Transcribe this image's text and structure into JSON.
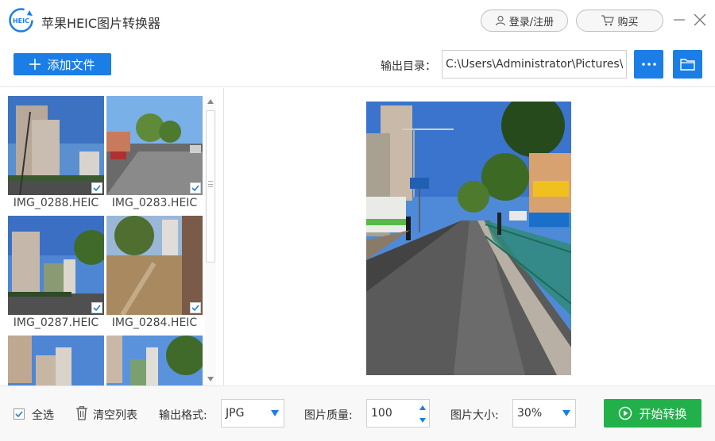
{
  "app": {
    "title": "苹果HEIC图片转换器",
    "logo_text": "HEIC",
    "login_label": "登录/注册",
    "buy_label": "购买"
  },
  "toolbar": {
    "add_file_label": "添加文件",
    "output_dir_label": "输出目录：",
    "output_dir_value": "C:\\Users\\Administrator\\Pictures\\",
    "more_icon": "ellipsis-icon",
    "folder_icon": "folder-icon"
  },
  "files": [
    {
      "name": "IMG_0288.HEIC",
      "checked": true
    },
    {
      "name": "IMG_0283.HEIC",
      "checked": true
    },
    {
      "name": "IMG_0287.HEIC",
      "checked": true
    },
    {
      "name": "IMG_0284.HEIC",
      "checked": true
    },
    {
      "name": "",
      "checked": false
    },
    {
      "name": "",
      "checked": false
    }
  ],
  "bottom": {
    "select_all_label": "全选",
    "clear_list_label": "清空列表",
    "format_label": "输出格式:",
    "format_value": "JPG",
    "quality_label": "图片质量:",
    "quality_value": "100",
    "size_label": "图片大小:",
    "size_value": "30%",
    "start_label": "开始转换"
  },
  "colors": {
    "accent_blue": "#1a7ee6",
    "start_green": "#22b04a"
  }
}
